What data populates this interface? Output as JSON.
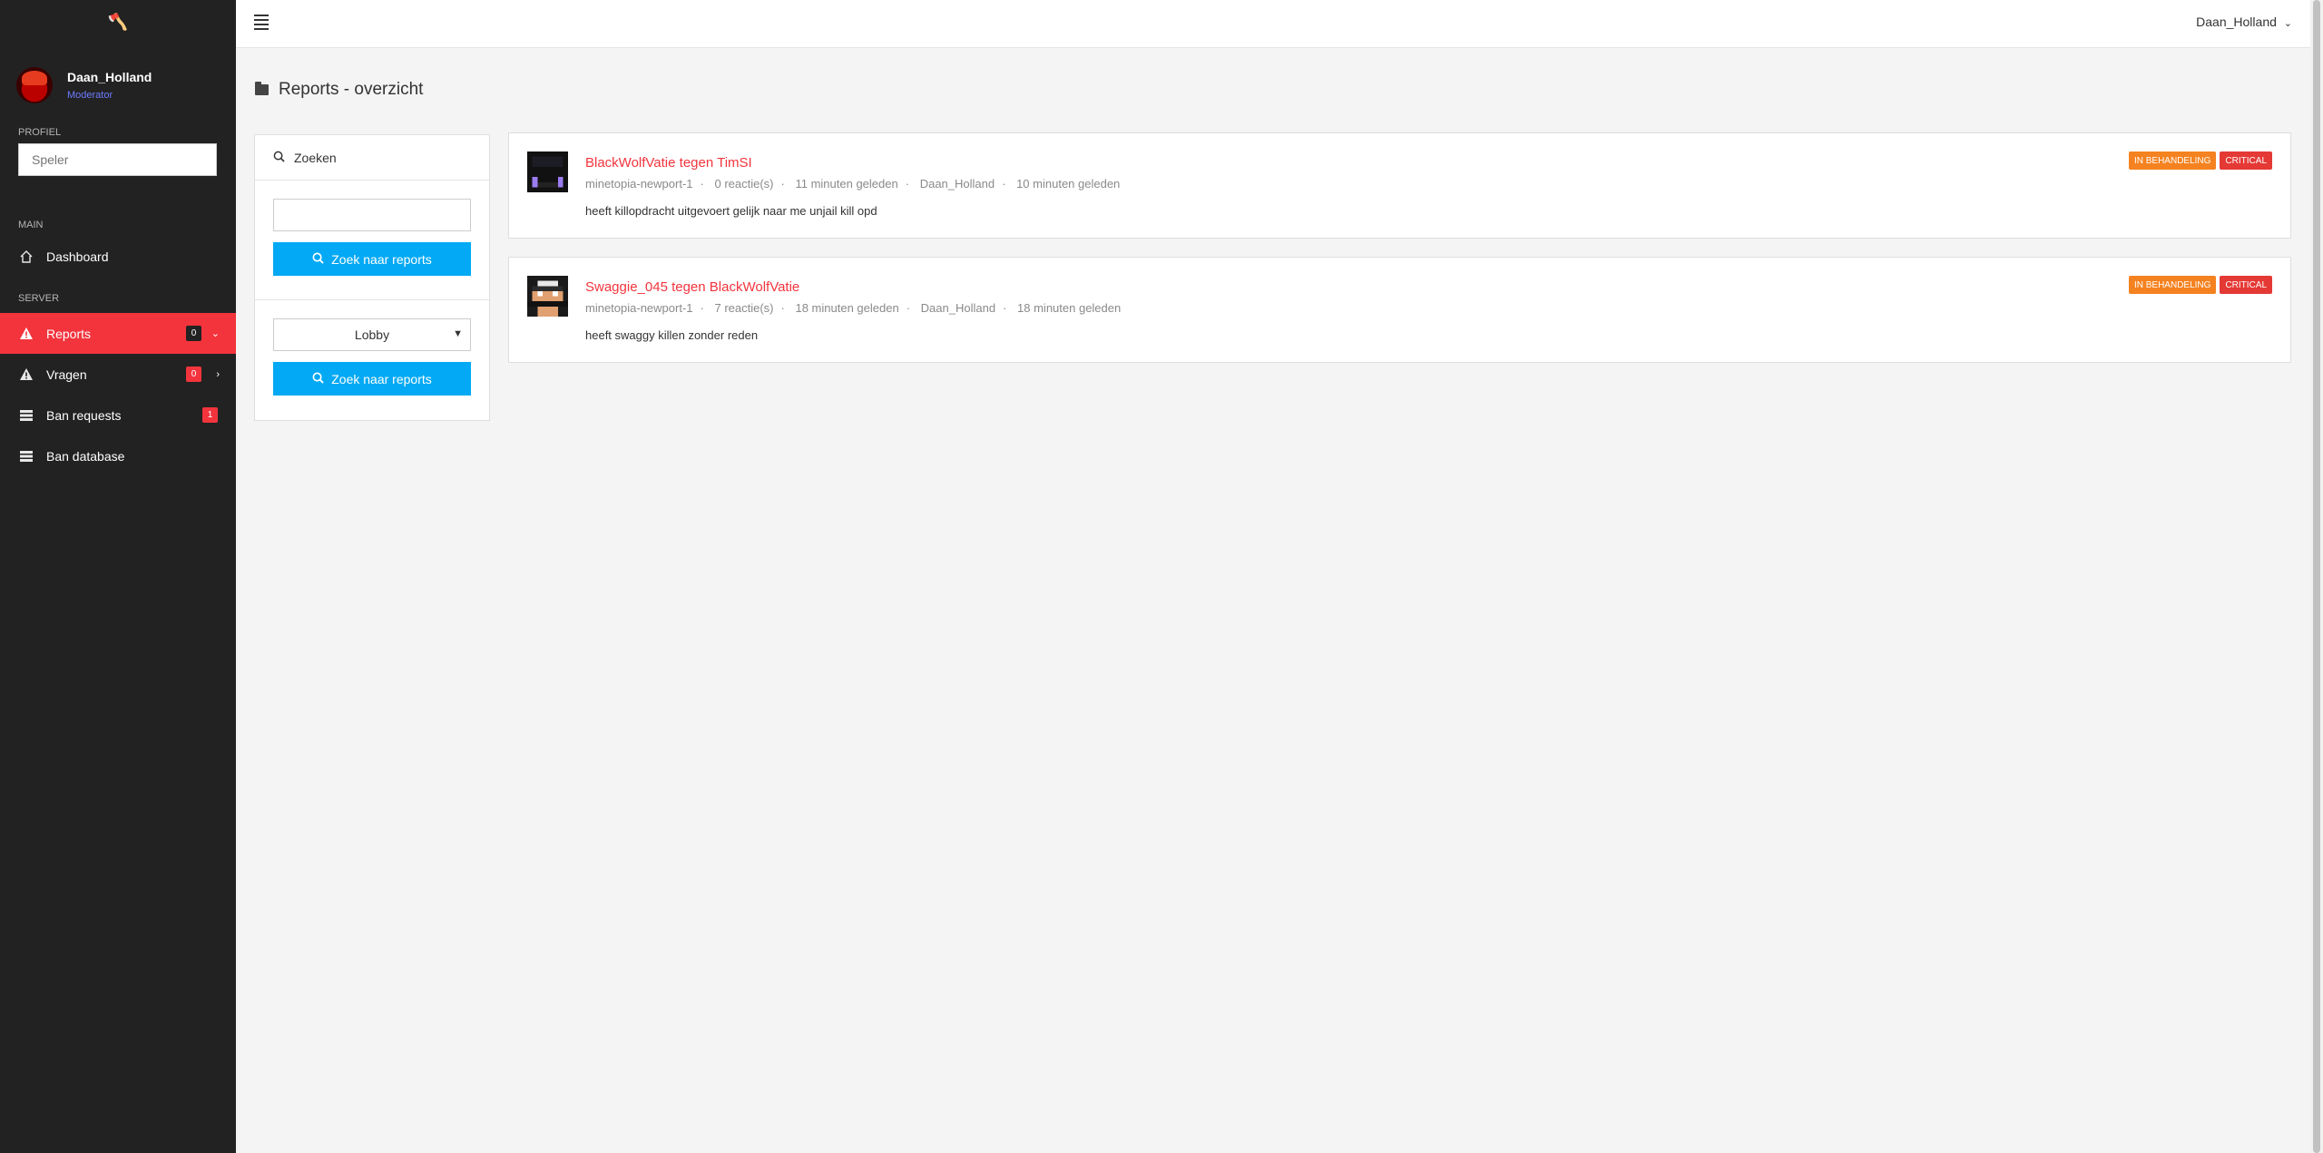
{
  "sidebar": {
    "logo": "🪓",
    "user": {
      "name": "Daan_Holland",
      "role": "Moderator"
    },
    "profiel_label": "PROFIEL",
    "speler_placeholder": "Speler",
    "main_label": "MAIN",
    "server_label": "SERVER",
    "items": [
      {
        "label": "Dashboard",
        "icon": "home-icon"
      },
      {
        "label": "Reports",
        "badge": "0",
        "icon": "warning-icon",
        "active": true
      },
      {
        "label": "Vragen",
        "badge": "0",
        "icon": "warning-icon"
      },
      {
        "label": "Ban requests",
        "badge": "1",
        "icon": "database-icon"
      },
      {
        "label": "Ban database",
        "icon": "database-icon"
      }
    ]
  },
  "topbar": {
    "user": "Daan_Holland"
  },
  "page": {
    "title": "Reports - overzicht"
  },
  "search": {
    "header": "Zoeken",
    "button_label": "Zoek naar reports",
    "select_value": "Lobby"
  },
  "reports": [
    {
      "title": "BlackWolfVatie tegen TimSI",
      "server": "minetopia-newport-1",
      "reacties": "0 reactie(s)",
      "created": "11 minuten geleden",
      "handler": "Daan_Holland",
      "updated": "10 minuten geleden",
      "body": "heeft killopdracht uitgevoert gelijk naar me unjail kill opd",
      "status": "IN BEHANDELING",
      "priority": "CRITICAL"
    },
    {
      "title": "Swaggie_045 tegen BlackWolfVatie",
      "server": "minetopia-newport-1",
      "reacties": "7 reactie(s)",
      "created": "18 minuten geleden",
      "handler": "Daan_Holland",
      "updated": "18 minuten geleden",
      "body": "heeft swaggy killen zonder reden",
      "status": "IN BEHANDELING",
      "priority": "CRITICAL"
    }
  ],
  "colors": {
    "sidebar_bg": "#222222",
    "accent_red": "#f3343d",
    "button_blue": "#03a9f4",
    "badge_orange": "#f58220"
  }
}
